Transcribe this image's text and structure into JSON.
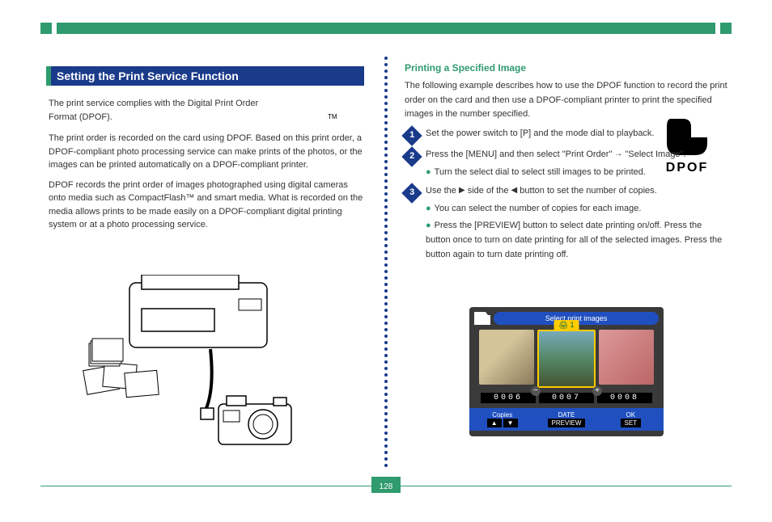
{
  "page_number": "128",
  "section_title": "Setting the Print Service Function",
  "left": {
    "intro": "The print service complies with the Digital Print Order Format (DPOF).",
    "para1": "The print order is recorded on the card using DPOF. Based on this print order, a DPOF-compliant photo processing service can make prints of the photos, or the images can be printed automatically on a DPOF-compliant printer.",
    "para2": "DPOF records the print order of images photographed using digital cameras onto media such as CompactFlash™ and smart media. What is recorded on the media allows prints to be made easily on a DPOF-compliant digital printing system or at a photo processing service.",
    "dpof_label": "DPOF",
    "tm": "TM"
  },
  "right": {
    "heading": "Printing a Specified Image",
    "intro": "The following example describes how to use the DPOF function to record the print order on the card and then use a DPOF-compliant printer to print the specified images in the number specified.",
    "step1": "Set the power switch to [P] and the mode dial to playback.",
    "step2_a": "Press the [MENU] and then select \"Print Order\" ",
    "step2_b": " \"Select Image\".",
    "bullet_step2": "Turn the select dial to select still images to be printed.",
    "step3_a": "Use the ",
    "step3_b": " side of the ",
    "step3_c": " button to set the number of copies.",
    "bullet_step3_1": "You can select the number of copies for each image.",
    "bullet_step3_2": "Press the [PREVIEW] button to select date printing on/off. Press the button once to turn on date printing for all of the selected images. Press the button again to turn date printing off.",
    "lcd": {
      "title": "Select print images",
      "badge": "1",
      "counters": [
        "0006",
        "0007",
        "0008"
      ],
      "footer": {
        "copies": "Copies",
        "date": "DATE",
        "preview": "PREVIEW",
        "ok": "OK",
        "set": "SET"
      }
    }
  }
}
